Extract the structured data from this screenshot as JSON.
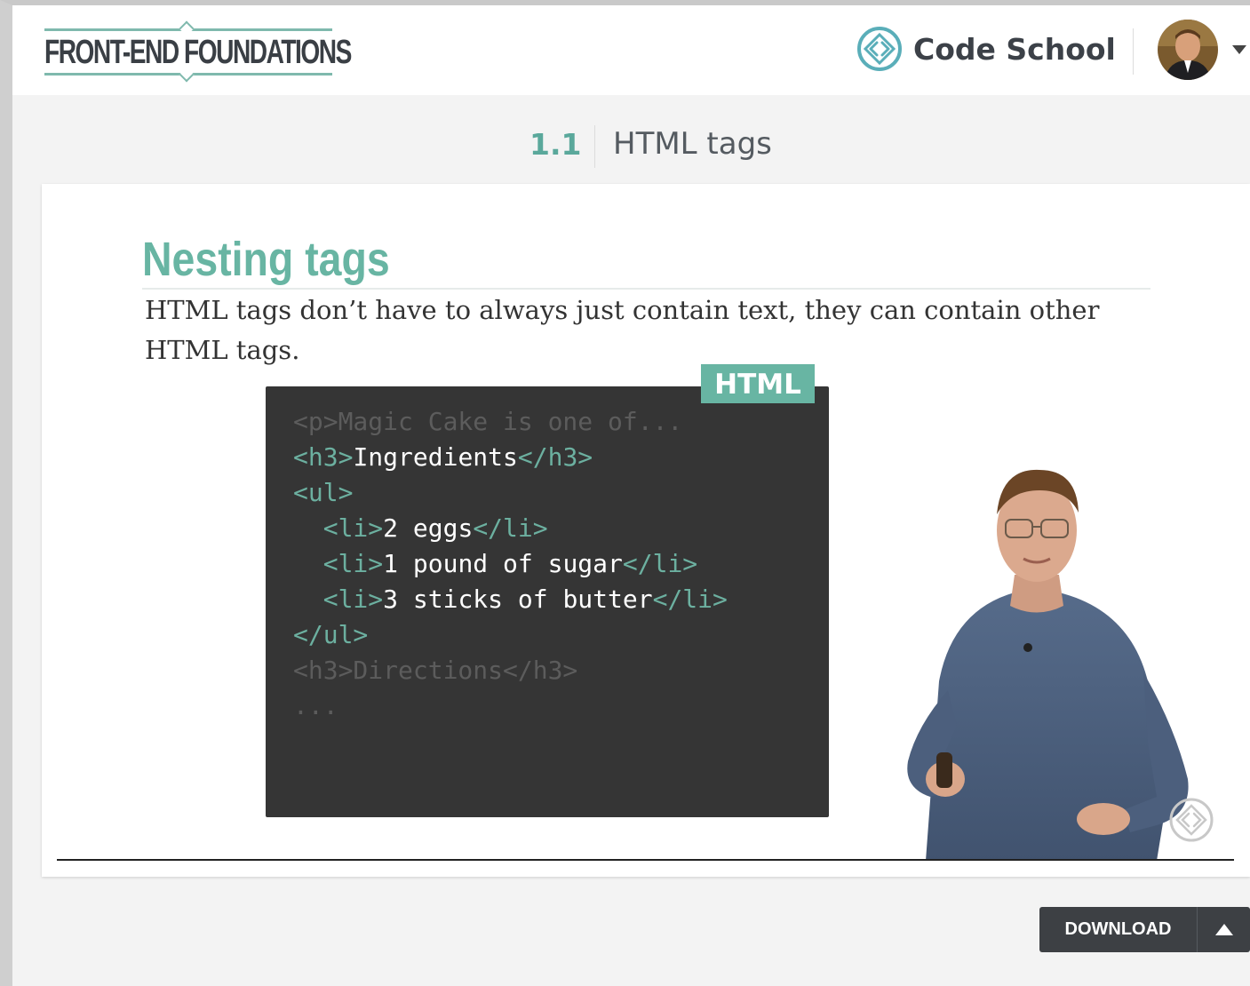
{
  "header": {
    "course_title": "FRONT-END FOUNDATIONS",
    "brand_name": "Code School",
    "brand_icon": "code-school-icon",
    "avatar_icon": "user-avatar",
    "menu_icon": "caret-down-icon"
  },
  "lesson": {
    "number": "1.1",
    "name": "HTML tags"
  },
  "slide": {
    "title": "Nesting tags",
    "body": "HTML tags don’t have to always just contain text, they can contain other HTML tags.",
    "code_label": "HTML",
    "code_lines": [
      {
        "indent": "",
        "parts": [
          {
            "t": "<p>Magic Cake is one of...",
            "c": "dim"
          }
        ]
      },
      {
        "indent": "",
        "parts": [
          {
            "t": "<h3>",
            "c": "tag"
          },
          {
            "t": "Ingredients",
            "c": "text"
          },
          {
            "t": "</h3>",
            "c": "tag"
          }
        ]
      },
      {
        "indent": "",
        "parts": [
          {
            "t": "<ul>",
            "c": "tag"
          }
        ]
      },
      {
        "indent": "  ",
        "parts": [
          {
            "t": "<li>",
            "c": "tag"
          },
          {
            "t": "2 eggs",
            "c": "text"
          },
          {
            "t": "</li>",
            "c": "tag"
          }
        ]
      },
      {
        "indent": "  ",
        "parts": [
          {
            "t": "<li>",
            "c": "tag"
          },
          {
            "t": "1 pound of sugar",
            "c": "text"
          },
          {
            "t": "</li>",
            "c": "tag"
          }
        ]
      },
      {
        "indent": "  ",
        "parts": [
          {
            "t": "<li>",
            "c": "tag"
          },
          {
            "t": "3 sticks of butter",
            "c": "text"
          },
          {
            "t": "</li>",
            "c": "tag"
          }
        ]
      },
      {
        "indent": "",
        "parts": [
          {
            "t": "</ul>",
            "c": "tag"
          }
        ]
      },
      {
        "indent": "",
        "parts": [
          {
            "t": "<h3>Directions</h3>",
            "c": "dim"
          }
        ]
      },
      {
        "indent": "",
        "parts": [
          {
            "t": "...",
            "c": "dim"
          }
        ]
      }
    ]
  },
  "player": {
    "watermark_icon": "code-school-watermark-icon"
  },
  "download": {
    "label": "DOWNLOAD",
    "arrow_icon": "caret-up-icon"
  },
  "colors": {
    "accent": "#68b5a3",
    "code_bg": "#353535",
    "button_bg": "#3d4044"
  }
}
